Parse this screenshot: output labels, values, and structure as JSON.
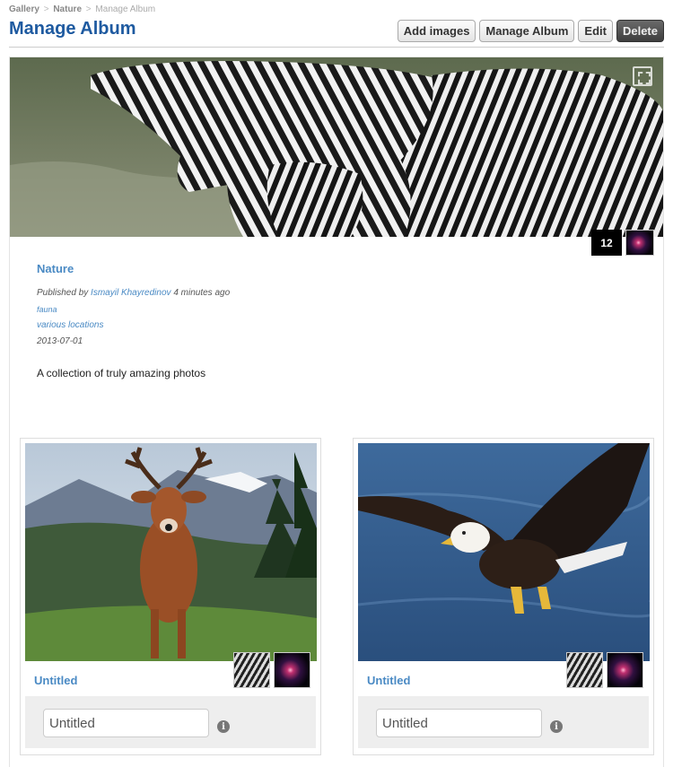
{
  "breadcrumb": {
    "items": [
      "Gallery",
      "Nature",
      "Manage Album"
    ],
    "separator": ">"
  },
  "page_title": "Manage Album",
  "toolbar": {
    "add_images": "Add images",
    "manage_album": "Manage Album",
    "edit": "Edit",
    "delete": "Delete"
  },
  "album": {
    "cover_icon": "expand-icon",
    "image_count": "12",
    "name": "Nature",
    "published_prefix": "Published by",
    "author": "Ismayil Khayredinov",
    "published_ago": "4 minutes ago",
    "tag": "fauna",
    "location": "various locations",
    "date": "2013-07-01",
    "description": "A collection of truly amazing photos"
  },
  "photos": [
    {
      "title": "Untitled",
      "caption_value": "Untitled",
      "subject": "deer",
      "info_icon": "info-icon"
    },
    {
      "title": "Untitled",
      "caption_value": "Untitled",
      "subject": "eagle",
      "info_icon": "info-icon"
    }
  ],
  "colors": {
    "title": "#1e5aa0",
    "link": "#4a8ac4",
    "delete_button": "#4a4a4a"
  }
}
